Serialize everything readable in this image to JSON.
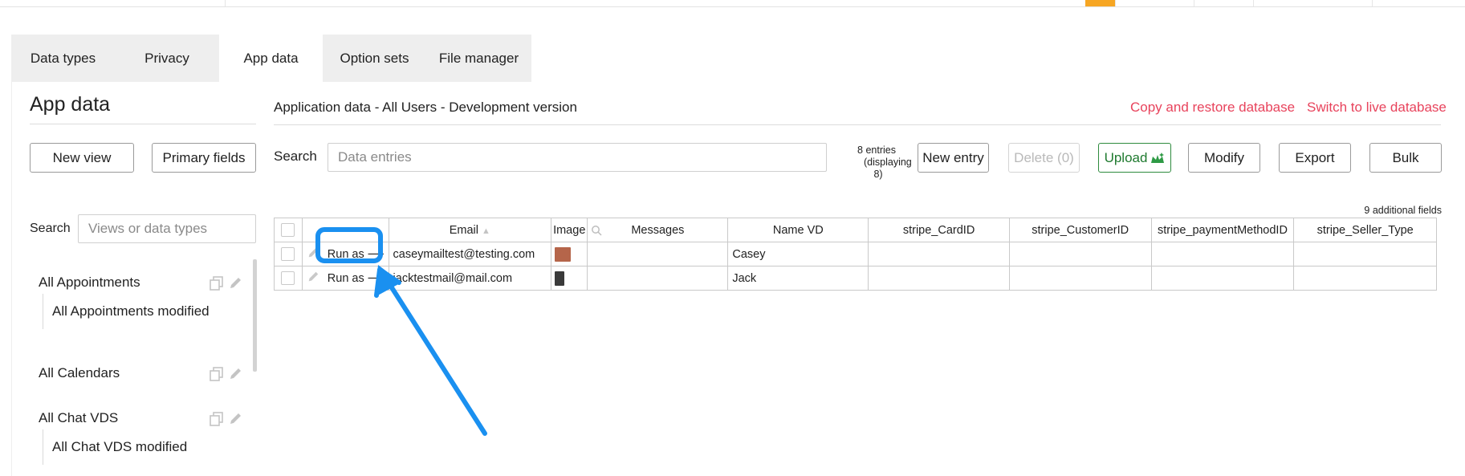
{
  "tabs": [
    {
      "label": "Data types",
      "active": false
    },
    {
      "label": "Privacy",
      "active": false
    },
    {
      "label": "App data",
      "active": true
    },
    {
      "label": "Option sets",
      "active": false
    },
    {
      "label": "File manager",
      "active": false
    }
  ],
  "sidebar": {
    "title": "App data",
    "new_view_label": "New view",
    "primary_fields_label": "Primary fields",
    "search_label": "Search",
    "search_placeholder": "Views or data types",
    "items": [
      {
        "label": "All Appointments",
        "type": "view"
      },
      {
        "label": "All Appointments modified",
        "type": "sub"
      },
      {
        "label": "All Calendars",
        "type": "view"
      },
      {
        "label": "All Chat VDS",
        "type": "view"
      },
      {
        "label": "All Chat VDS modified",
        "type": "sub"
      }
    ]
  },
  "main": {
    "header": "Application data - All Users - Development version",
    "copy_restore_label": "Copy and restore database",
    "switch_live_label": "Switch to live database",
    "search_label": "Search",
    "search_placeholder": "Data entries",
    "entries_line1": "8 entries",
    "entries_line2": "(displaying",
    "entries_line3": "8)",
    "buttons": {
      "new_entry": "New entry",
      "delete": "Delete (0)",
      "upload": "Upload",
      "modify": "Modify",
      "export": "Export",
      "bulk": "Bulk"
    },
    "additional_fields": "9 additional fields"
  },
  "table": {
    "columns": [
      "Email",
      "Image",
      "Messages",
      "Name VD",
      "stripe_CardID",
      "stripe_CustomerID",
      "stripe_paymentMethodID",
      "stripe_Seller_Type"
    ],
    "sort_indicator": "▲",
    "rows": [
      {
        "run_as": "Run as ⟶",
        "email": "caseymailtest@testing.com",
        "name": "Casey",
        "avatar_color": "#b5654a"
      },
      {
        "run_as": "Run as ⟶",
        "email": "jacktestmail@mail.com",
        "name": "Jack",
        "avatar_color": "#3a3a3a"
      }
    ]
  },
  "colors": {
    "accent_orange": "#f6a623",
    "link_red": "#e8435c",
    "upload_green": "#2e8b3e",
    "annotation_blue": "#1a90f0"
  }
}
